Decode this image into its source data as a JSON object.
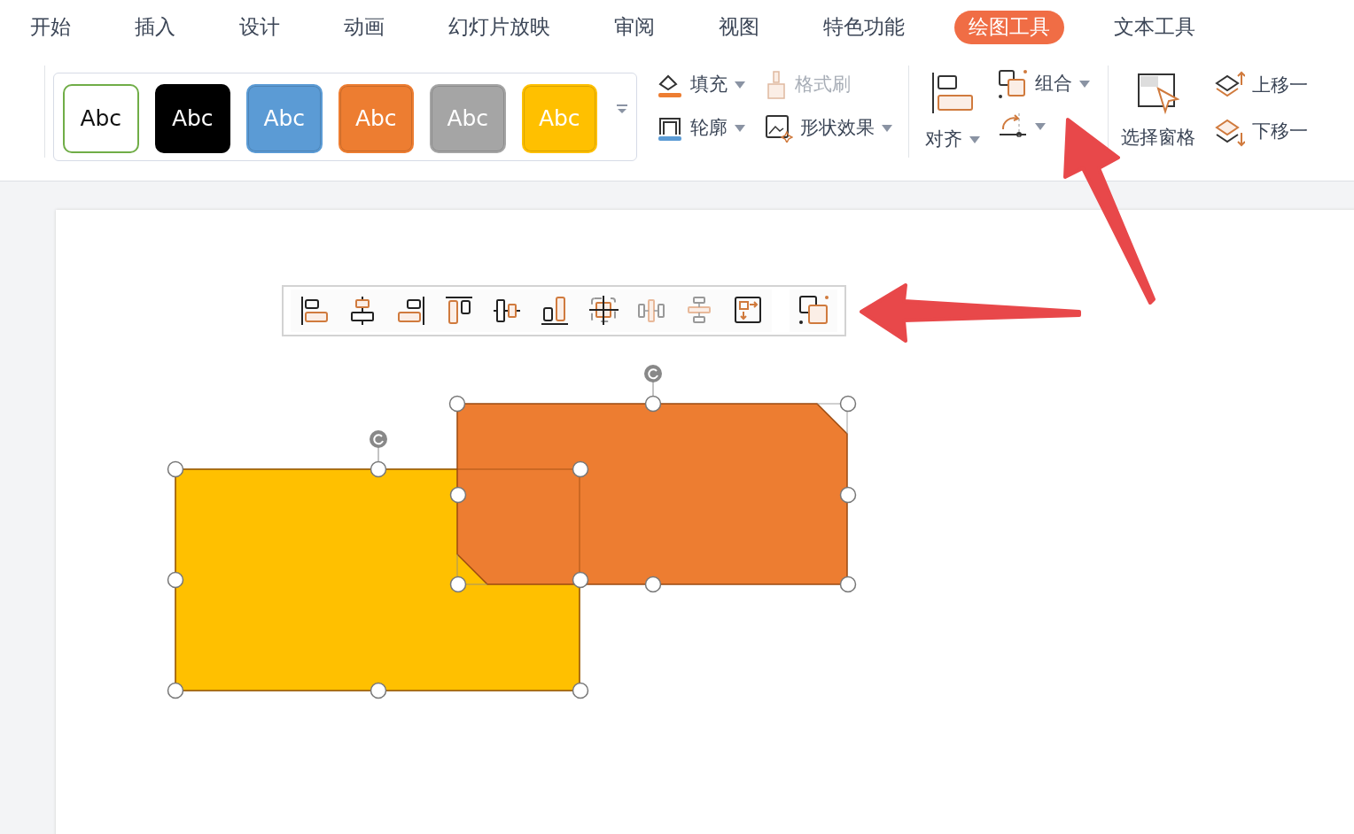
{
  "tabs": [
    {
      "label": "开始",
      "selected": false
    },
    {
      "label": "插入",
      "selected": false
    },
    {
      "label": "设计",
      "selected": false
    },
    {
      "label": "动画",
      "selected": false
    },
    {
      "label": "幻灯片放映",
      "selected": false
    },
    {
      "label": "审阅",
      "selected": false
    },
    {
      "label": "视图",
      "selected": false
    },
    {
      "label": "特色功能",
      "selected": false
    },
    {
      "label": "绘图工具",
      "selected": true
    },
    {
      "label": "文本工具",
      "selected": false
    }
  ],
  "style_swatches": [
    {
      "label": "Abc",
      "kind": "outline",
      "color": "#70ad47"
    },
    {
      "label": "Abc",
      "kind": "filled",
      "color": "#000000"
    },
    {
      "label": "Abc",
      "kind": "filled",
      "color": "#5b9bd5"
    },
    {
      "label": "Abc",
      "kind": "filled",
      "color": "#ed7d31"
    },
    {
      "label": "Abc",
      "kind": "filled",
      "color": "#a5a5a5"
    },
    {
      "label": "Abc",
      "kind": "filled",
      "color": "#ffc000"
    }
  ],
  "format_buttons": [
    {
      "kind": "fill",
      "label": "填充",
      "disabled": false
    },
    {
      "kind": "painter",
      "label": "格式刷",
      "disabled": true
    },
    {
      "kind": "outline",
      "label": "轮廓",
      "disabled": false
    },
    {
      "kind": "effects",
      "label": "形状效果",
      "disabled": false
    }
  ],
  "arrange_buttons": [
    {
      "kind": "group",
      "label": "组合"
    },
    {
      "kind": "rotate"
    }
  ],
  "align_button": {
    "label": "对齐"
  },
  "selection_pane_button": {
    "label": "选择窗格"
  },
  "layer_buttons": [
    {
      "kind": "up",
      "label": "上移一"
    },
    {
      "kind": "down",
      "label": "下移一"
    }
  ]
}
